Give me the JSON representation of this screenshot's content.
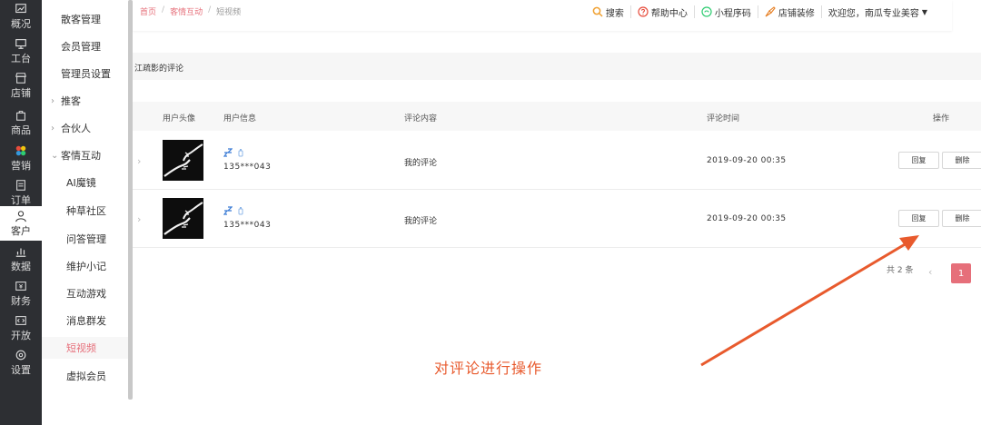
{
  "rail": {
    "items": [
      {
        "label": "概况",
        "icon": "overview-icon"
      },
      {
        "label": "工台",
        "icon": "desk-icon"
      },
      {
        "label": "店铺",
        "icon": "store-icon"
      },
      {
        "label": "商品",
        "icon": "product-icon"
      },
      {
        "label": "营销",
        "icon": "marketing-icon"
      },
      {
        "label": "订单",
        "icon": "order-icon"
      },
      {
        "label": "客户",
        "icon": "customer-icon"
      },
      {
        "label": "数据",
        "icon": "data-icon"
      },
      {
        "label": "财务",
        "icon": "finance-icon"
      },
      {
        "label": "开放",
        "icon": "open-icon"
      },
      {
        "label": "设置",
        "icon": "settings-icon"
      }
    ],
    "active_index": 6
  },
  "submenu": {
    "items": [
      {
        "label": "散客管理",
        "level": "lvl1"
      },
      {
        "label": "会员管理",
        "level": "lvl1"
      },
      {
        "label": "管理员设置",
        "level": "lvl1"
      },
      {
        "label": "推客",
        "level": "grp",
        "caret": "›"
      },
      {
        "label": "合伙人",
        "level": "grp",
        "caret": "›"
      },
      {
        "label": "客情互动",
        "level": "grp",
        "caret": "⌄"
      },
      {
        "label": "AI魔镜",
        "level": "lvl2"
      },
      {
        "label": "种草社区",
        "level": "lvl2"
      },
      {
        "label": "问答管理",
        "level": "lvl2"
      },
      {
        "label": "维护小记",
        "level": "lvl2"
      },
      {
        "label": "互动游戏",
        "level": "lvl2"
      },
      {
        "label": "消息群发",
        "level": "lvl2"
      },
      {
        "label": "短视频",
        "level": "lvl2",
        "active": true
      },
      {
        "label": "虚拟会员",
        "level": "lvl2"
      }
    ]
  },
  "breadcrumb": [
    "首页",
    "客情互动",
    "短视频"
  ],
  "toolbar": {
    "search": "搜索",
    "help": "帮助中心",
    "mini_program": "小程序码",
    "decorate": "店铺装修",
    "welcome": "欢迎您，南瓜专业美容"
  },
  "section_title": "江疏影的评论",
  "table": {
    "headers": [
      "用户头像",
      "用户信息",
      "评论内容",
      "评论时间",
      "操作"
    ],
    "rows": [
      {
        "phone": "135***043",
        "content": "我的评论",
        "time": "2019-09-20 00:35",
        "reply": "回复",
        "delete": "删除"
      },
      {
        "phone": "135***043",
        "content": "我的评论",
        "time": "2019-09-20 00:35",
        "reply": "回复",
        "delete": "删除"
      }
    ]
  },
  "pagination": {
    "total": "共 2 条",
    "page": "1"
  },
  "annotation": "对评论进行操作",
  "colors": {
    "accent": "#e66f7a",
    "rail_bg": "#2d2f33",
    "annotation": "#e85a2d"
  }
}
